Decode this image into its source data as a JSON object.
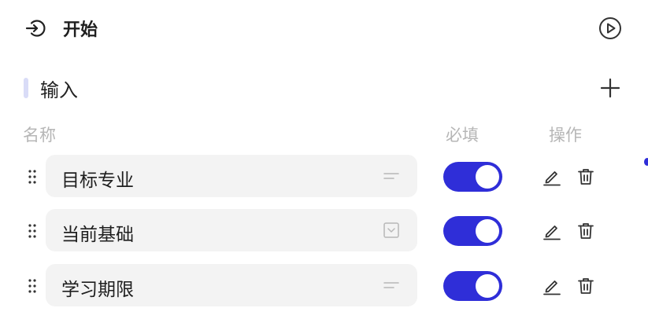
{
  "header": {
    "title": "开始",
    "enter_icon": "enter-icon",
    "run_icon": "play-circle-icon"
  },
  "section": {
    "label": "输入",
    "add_icon": "plus-icon"
  },
  "columns": {
    "name": "名称",
    "required": "必填",
    "actions": "操作"
  },
  "rows": [
    {
      "name": "目标专业",
      "type_icon": "text-lines-icon",
      "required": true
    },
    {
      "name": "当前基础",
      "type_icon": "dropdown-icon",
      "required": true
    },
    {
      "name": "学习期限",
      "type_icon": "text-lines-icon",
      "required": true
    }
  ],
  "colors": {
    "accent": "#2f2ed8",
    "field_bg": "#f3f3f3",
    "muted": "#b6b6b6",
    "section_bar": "#d9dcf7"
  }
}
